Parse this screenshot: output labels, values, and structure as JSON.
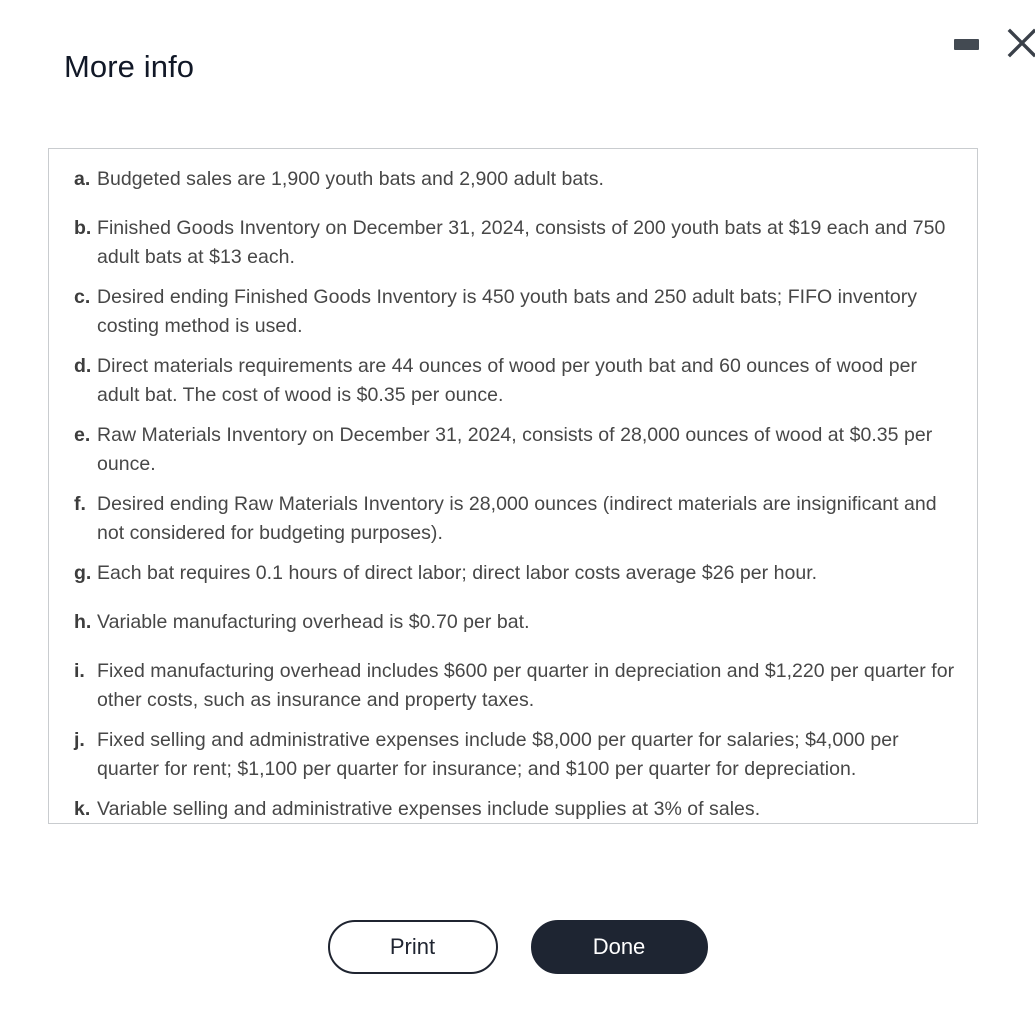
{
  "dialog": {
    "title": "More info",
    "controls": {
      "minimize_name": "minimize-icon",
      "close_name": "close-icon"
    }
  },
  "info_box": {
    "items": [
      {
        "marker": "a.",
        "text": "Budgeted sales are 1,900 youth bats and 2,900 adult bats.",
        "single_line": true
      },
      {
        "marker": "b.",
        "text": "Finished Goods Inventory on December 31, 2024, consists of 200 youth bats at $19 each and 750 adult bats at $13 each.",
        "single_line": false
      },
      {
        "marker": "c.",
        "text": "Desired ending Finished Goods Inventory is 450 youth bats and 250 adult bats; FIFO inventory costing method is used.",
        "single_line": false
      },
      {
        "marker": "d.",
        "text": "Direct materials requirements are 44 ounces of wood per youth bat and 60 ounces of wood per adult bat. The cost of wood is $0.35 per ounce.",
        "single_line": false
      },
      {
        "marker": "e.",
        "text": "Raw Materials Inventory on December 31, 2024, consists of 28,000 ounces of wood at $0.35 per ounce.",
        "single_line": false
      },
      {
        "marker": "f.",
        "text": "Desired ending Raw Materials Inventory is 28,000 ounces (indirect materials are insignificant and not considered for budgeting purposes).",
        "single_line": false
      },
      {
        "marker": "g.",
        "text": "Each bat requires 0.1 hours of direct labor; direct labor costs average $26 per hour.",
        "single_line": true
      },
      {
        "marker": "h.",
        "text": "Variable manufacturing overhead is $0.70 per bat.",
        "single_line": true
      },
      {
        "marker": "i.",
        "text": "Fixed manufacturing overhead includes $600 per quarter in depreciation and $1,220 per quarter for other costs, such as insurance and property taxes.",
        "single_line": false
      },
      {
        "marker": "j.",
        "text": "Fixed selling and administrative expenses include $8,000 per quarter for salaries; $4,000 per quarter for rent; $1,100 per quarter for insurance; and $100 per quarter for depreciation.",
        "single_line": false
      },
      {
        "marker": "k.",
        "text": "Variable selling and administrative expenses include supplies at 3% of sales.",
        "single_line": true
      }
    ]
  },
  "footer": {
    "print_label": "Print",
    "done_label": "Done"
  },
  "colors": {
    "title_text": "#111827",
    "body_text": "#474747",
    "marker_text": "#3d3d3d",
    "box_border": "#c9cccf",
    "primary_button_bg": "#1e2532",
    "secondary_button_border": "#1f2430",
    "control_icon": "#434a52",
    "page_background": "#ffffff"
  }
}
